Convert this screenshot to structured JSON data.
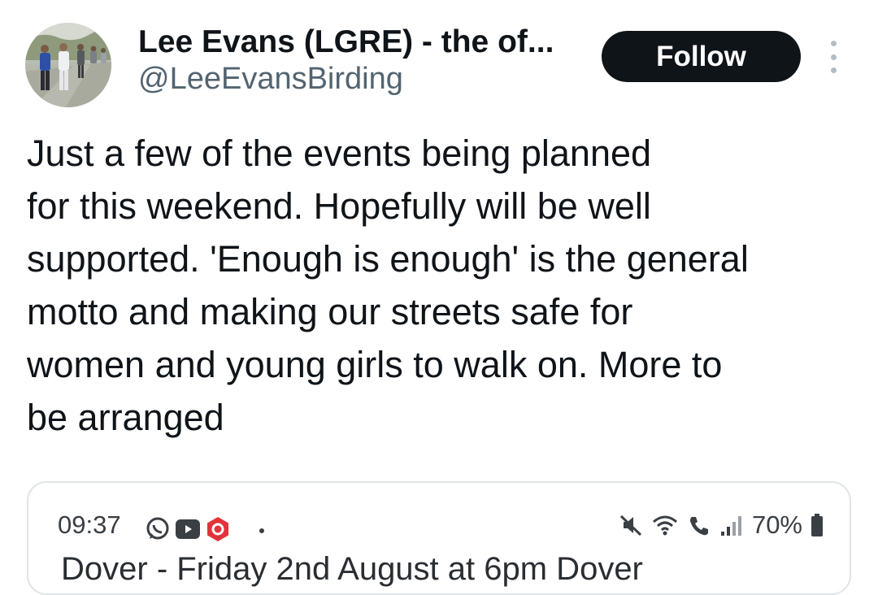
{
  "author": {
    "display_name": "Lee Evans (LGRE) - the of...",
    "handle": "@LeeEvansBirding",
    "avatar_icon": "profile-photo"
  },
  "actions": {
    "follow_label": "Follow",
    "more_icon": "more-vertical-icon"
  },
  "tweet": {
    "lines": [
      "Just a few of the events being planned",
      "for this weekend. Hopefully will be well",
      "supported. 'Enough is enough' is the general",
      "motto and making our streets safe for",
      "women and young girls to walk on. More to",
      "be arranged"
    ]
  },
  "embedded_screenshot": {
    "status_time": "09:37",
    "left_icons": [
      "whatsapp-icon",
      "youtube-icon",
      "app-hexagon-icon"
    ],
    "right_icons": [
      "mute-icon",
      "wifi-icon",
      "call-icon",
      "signal-icon"
    ],
    "battery_percent": "70%",
    "partial_text": "Dover - Friday 2nd August at 6pm Dover"
  },
  "colors": {
    "text_primary": "#0f1419",
    "text_secondary": "#536471",
    "follow_bg": "#0f1419",
    "follow_text": "#ffffff",
    "card_border": "#e1e5e8"
  }
}
